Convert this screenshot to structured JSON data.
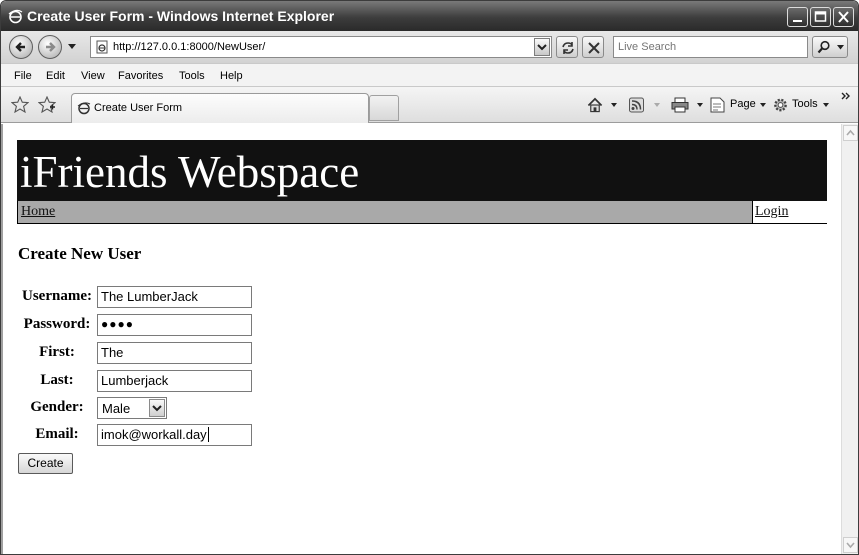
{
  "window": {
    "title": "Create User Form - Windows Internet Explorer"
  },
  "address_bar": {
    "url": "http://127.0.0.1:8000/NewUser/"
  },
  "search": {
    "placeholder": "Live Search"
  },
  "menu": {
    "items": [
      "File",
      "Edit",
      "View",
      "Favorites",
      "Tools",
      "Help"
    ]
  },
  "tabs": [
    {
      "label": "Create User Form"
    }
  ],
  "command_bar": {
    "page_label": "Page",
    "tools_label": "Tools"
  },
  "site": {
    "title": "iFriends Webspace",
    "nav_home": "Home",
    "nav_login": "Login"
  },
  "form": {
    "heading": "Create New User",
    "fields": [
      {
        "label": "Username:",
        "value": "The LumberJack"
      },
      {
        "label": "Password:",
        "value": "●●●●"
      },
      {
        "label": "First:",
        "value": "The"
      },
      {
        "label": "Last:",
        "value": "Lumberjack"
      },
      {
        "label": "Gender:",
        "value": "Male"
      },
      {
        "label": "Email:",
        "value": "imok@workall.day"
      }
    ],
    "submit_label": "Create"
  }
}
